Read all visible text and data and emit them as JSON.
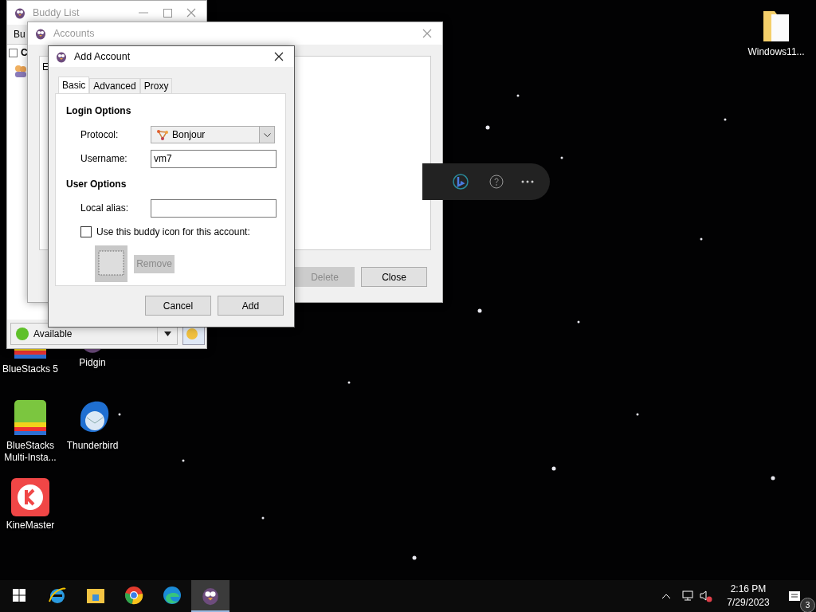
{
  "desktop_icons": [
    {
      "label": "Windows11...",
      "kind": "folder"
    },
    {
      "label": "BlueStacks 5",
      "kind": "bluestacks"
    },
    {
      "label": "Pidgin",
      "kind": "pidgin"
    },
    {
      "label": "BlueStacks Multi-Insta...",
      "kind": "bluestacks"
    },
    {
      "label": "Thunderbird",
      "kind": "thunderbird"
    },
    {
      "label": "KineMaster",
      "kind": "kinemaster"
    }
  ],
  "buddy_list": {
    "title": "Buddy List",
    "menu": "Bu",
    "group": "C",
    "status": "Available"
  },
  "accounts": {
    "title": "Accounts",
    "column": "E",
    "buttons": [
      {
        "label": "Delete",
        "disabled": true
      },
      {
        "label": "Close",
        "disabled": false
      }
    ]
  },
  "add_account": {
    "title": "Add Account",
    "tabs": [
      {
        "label": "Basic",
        "selected": true
      },
      {
        "label": "Advanced",
        "selected": false
      },
      {
        "label": "Proxy",
        "selected": false
      }
    ],
    "login_heading": "Login Options",
    "protocol_label": "Protocol:",
    "protocol": "Bonjour",
    "username_label": "Username:",
    "username": "vm7",
    "user_heading": "User Options",
    "alias_label": "Local alias:",
    "buddy_icon": {
      "label": "Use this buddy icon for this account:",
      "checked": false
    },
    "remove": {
      "label": "Remove",
      "disabled": true
    },
    "buttons": [
      {
        "label": "Cancel"
      },
      {
        "label": "Add"
      }
    ]
  },
  "taskbar": {
    "apps": [
      {
        "kind": "ie",
        "active": false
      },
      {
        "kind": "explorer",
        "active": false
      },
      {
        "kind": "chrome",
        "active": false
      },
      {
        "kind": "edge",
        "active": false
      },
      {
        "kind": "pidgin",
        "active": true
      }
    ],
    "time": "2:16 PM",
    "date": "7/29/2023",
    "notifications": "3"
  }
}
